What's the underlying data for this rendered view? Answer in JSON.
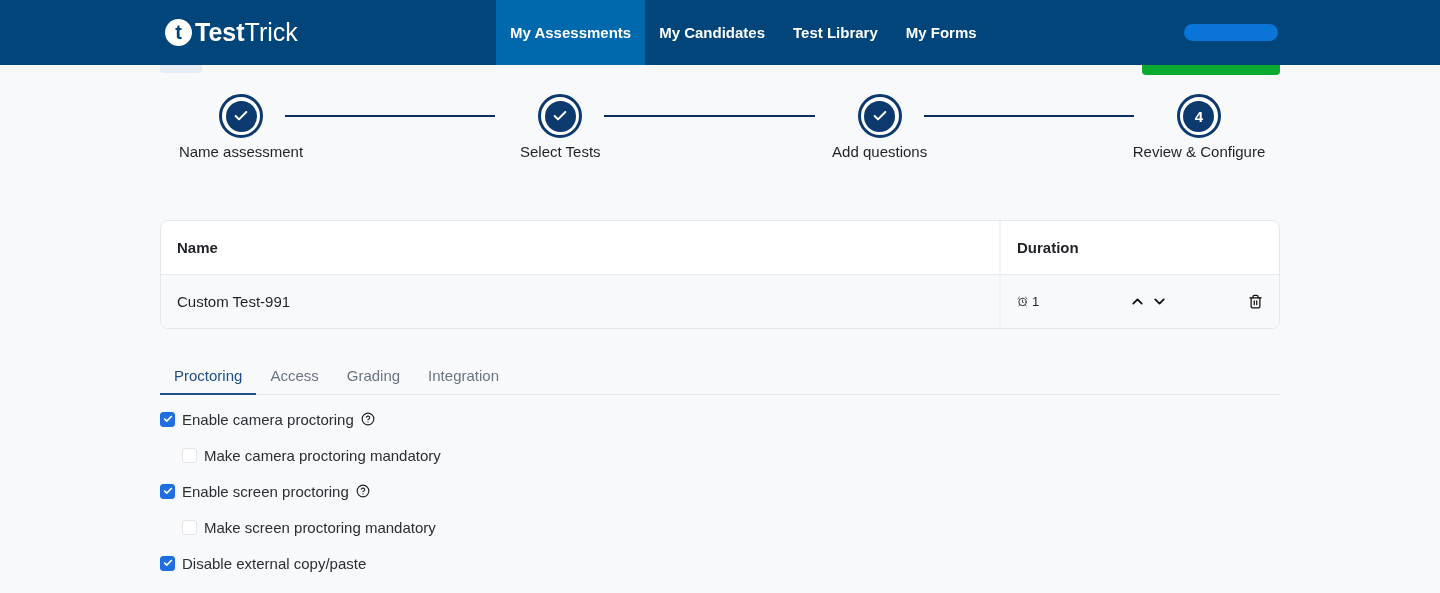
{
  "header": {
    "logo_mark": "t",
    "logo_text": "**Test**Trick",
    "nav": [
      {
        "label": "My Assessments",
        "selected": true
      },
      {
        "label": "My Candidates",
        "selected": false
      },
      {
        "label": "Test Library",
        "selected": false
      },
      {
        "label": "My Forms",
        "selected": false
      }
    ]
  },
  "stepper": [
    {
      "label": "Name assessment",
      "completed": true
    },
    {
      "label": "Select Tests",
      "completed": true
    },
    {
      "label": "Add questions",
      "completed": true
    },
    {
      "label": "Review & Configure",
      "completed": false,
      "number": "4"
    }
  ],
  "table": {
    "columns": [
      "Name",
      "Duration"
    ],
    "rows": [
      {
        "name": "Custom Test-991",
        "duration": "1"
      }
    ]
  },
  "tabs": [
    {
      "label": "Proctoring",
      "selected": true
    },
    {
      "label": "Access",
      "selected": false
    },
    {
      "label": "Grading",
      "selected": false
    },
    {
      "label": "Integration",
      "selected": false
    }
  ],
  "options": [
    {
      "label": "Enable camera proctoring",
      "checked": true,
      "help": true,
      "children": [
        {
          "label": "Make camera proctoring mandatory",
          "checked": false,
          "help": false
        }
      ]
    },
    {
      "label": "Enable screen proctoring",
      "checked": true,
      "help": true,
      "children": [
        {
          "label": "Make screen proctoring mandatory",
          "checked": false,
          "help": false
        }
      ]
    },
    {
      "label": "Disable external copy/paste",
      "checked": true,
      "help": false
    }
  ]
}
